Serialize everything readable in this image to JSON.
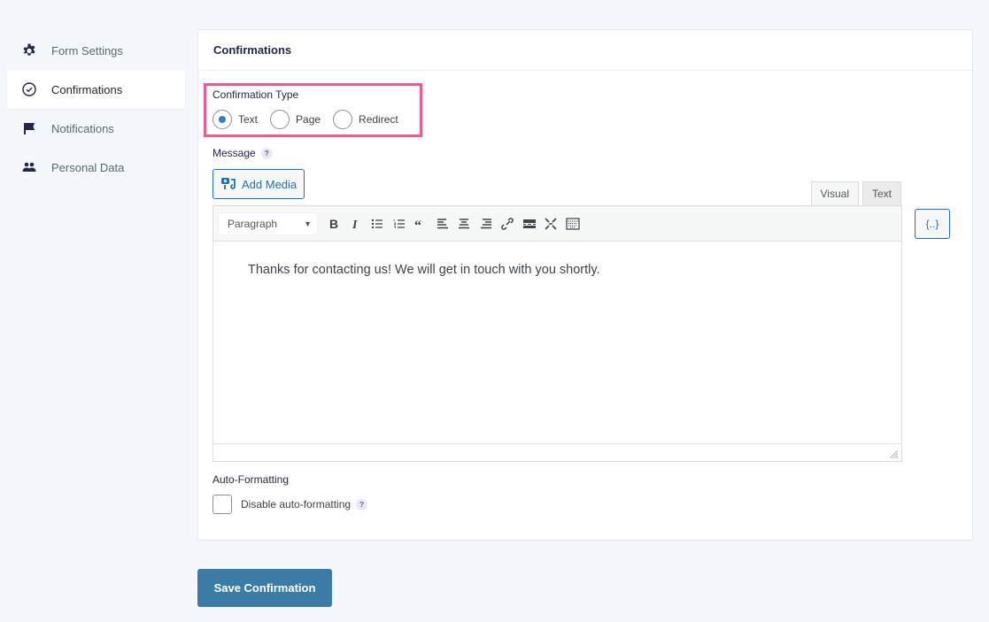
{
  "sidebar": {
    "items": [
      {
        "label": "Form Settings",
        "icon": "gear-icon",
        "active": false
      },
      {
        "label": "Confirmations",
        "icon": "check-circle-icon",
        "active": true
      },
      {
        "label": "Notifications",
        "icon": "flag-icon",
        "active": false
      },
      {
        "label": "Personal Data",
        "icon": "users-icon",
        "active": false
      }
    ]
  },
  "card": {
    "title": "Confirmations",
    "confirmation_type": {
      "label": "Confirmation Type",
      "options": [
        "Text",
        "Page",
        "Redirect"
      ],
      "selected": "Text"
    },
    "message": {
      "label": "Message",
      "help": "?",
      "add_media_label": "Add Media",
      "tabs": [
        "Visual",
        "Text"
      ],
      "active_tab": "Visual",
      "format_select": "Paragraph",
      "toolbar_buttons": [
        "bold",
        "italic",
        "bullet-list",
        "numbered-list",
        "blockquote",
        "align-left",
        "align-center",
        "align-right",
        "link",
        "read-more",
        "fullscreen",
        "toolbar-toggle"
      ],
      "content": "Thanks for contacting us! We will get in touch with you shortly.",
      "merge_tag_label": "{..}"
    },
    "auto_formatting": {
      "label": "Auto-Formatting",
      "checkbox_label": "Disable auto-formatting",
      "checked": false,
      "help": "?"
    }
  },
  "actions": {
    "save_label": "Save Confirmation"
  },
  "colors": {
    "accent": "#3a7ca5",
    "highlight": "#f0598f",
    "link": "#2271b1"
  }
}
